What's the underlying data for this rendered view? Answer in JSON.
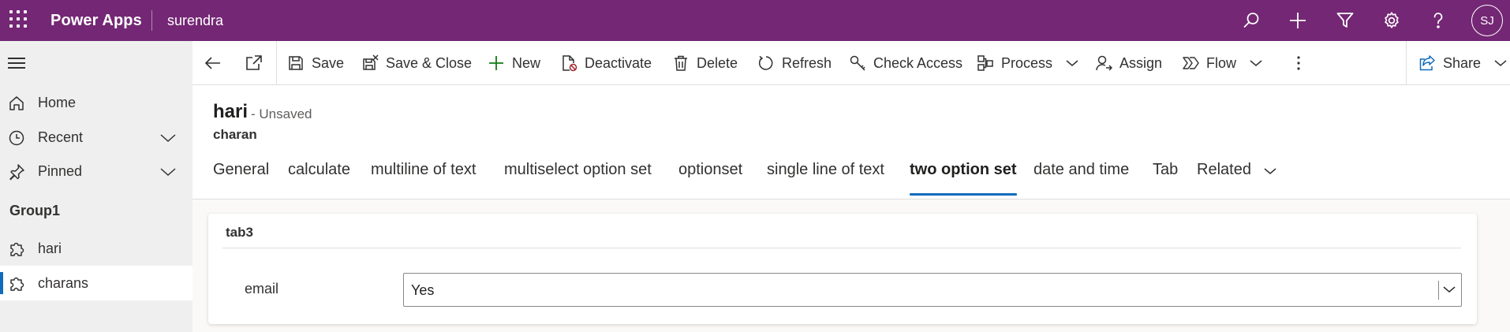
{
  "topbar": {
    "app_title": "Power Apps",
    "environment": "surendra",
    "avatar_initials": "SJ",
    "background": "#742774"
  },
  "nav": {
    "home": "Home",
    "recent": "Recent",
    "pinned": "Pinned",
    "group": "Group1",
    "items": [
      {
        "label": "hari"
      },
      {
        "label": "charans",
        "selected": true
      }
    ]
  },
  "commands": {
    "save": "Save",
    "save_close": "Save & Close",
    "new": "New",
    "deactivate": "Deactivate",
    "delete": "Delete",
    "refresh": "Refresh",
    "check_access": "Check Access",
    "process": "Process",
    "assign": "Assign",
    "flow": "Flow",
    "share": "Share"
  },
  "record": {
    "title": "hari",
    "status": "- Unsaved",
    "entity": "charan"
  },
  "tabs": [
    {
      "label": "General"
    },
    {
      "label": "calculate"
    },
    {
      "label": "multiline of text"
    },
    {
      "label": "multiselect option set"
    },
    {
      "label": "optionset"
    },
    {
      "label": "single line of text"
    },
    {
      "label": "two option set",
      "selected": true
    },
    {
      "label": "date and time"
    },
    {
      "label": "Tab"
    },
    {
      "label": "Related"
    }
  ],
  "section": {
    "title": "tab3",
    "field_label": "email",
    "field_value": "Yes"
  },
  "colors": {
    "accent": "#0f6cbd",
    "command_green": "#107c10"
  }
}
